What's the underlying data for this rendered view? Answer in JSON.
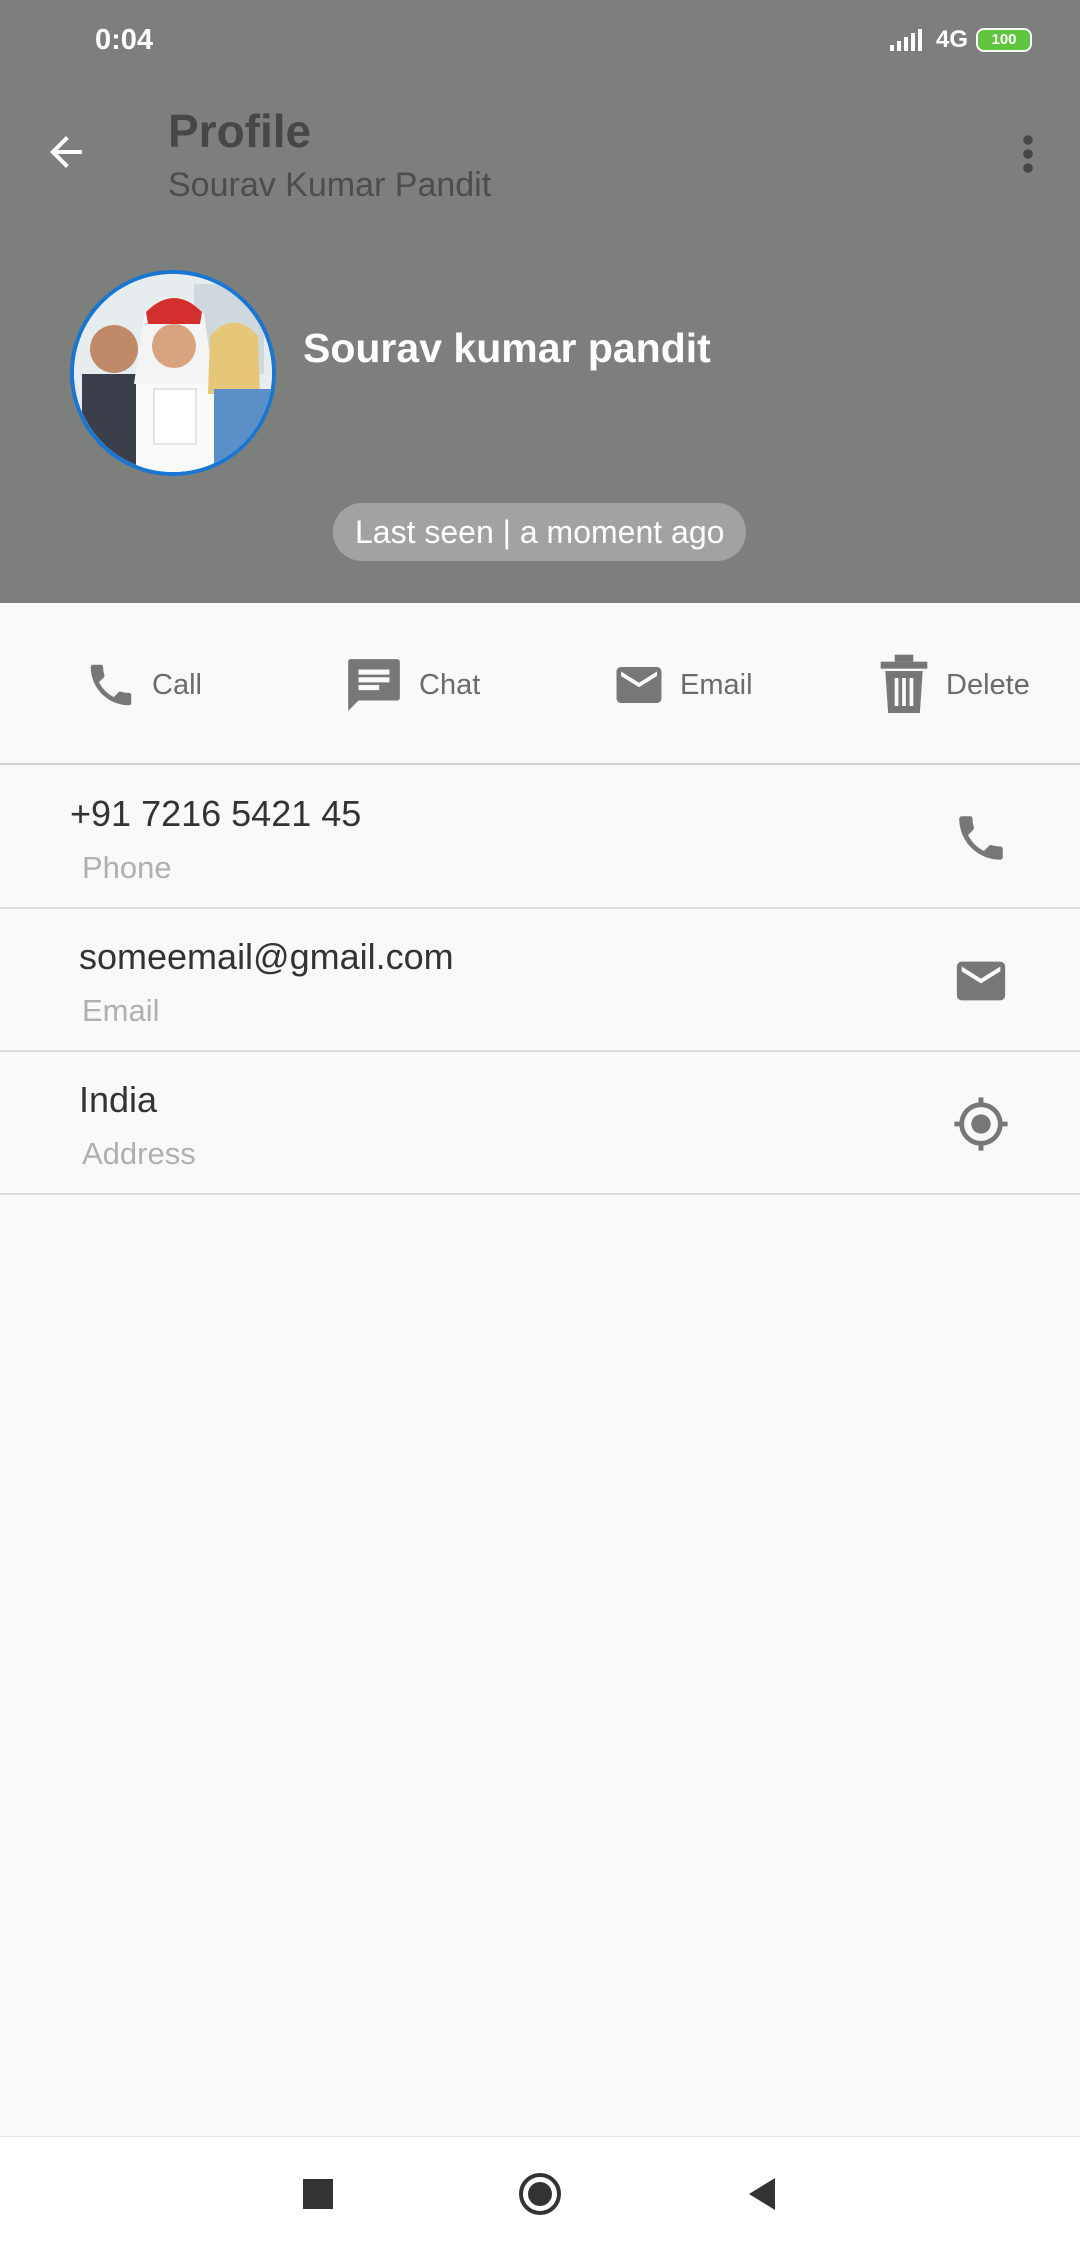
{
  "status_bar": {
    "time": "0:04",
    "network": "4G",
    "battery": "100"
  },
  "app_bar": {
    "title": "Profile",
    "subtitle": "Sourav Kumar Pandit"
  },
  "profile": {
    "name": "Sourav kumar pandit",
    "last_seen": "Last seen | a moment ago"
  },
  "actions": {
    "call": "Call",
    "chat": "Chat",
    "email": "Email",
    "delete": "Delete"
  },
  "details": {
    "phone": {
      "value": "+91 7216 5421 45",
      "label": "Phone"
    },
    "email": {
      "value": "someemail@gmail.com",
      "label": "Email"
    },
    "address": {
      "value": "India",
      "label": "Address"
    }
  },
  "colors": {
    "header_bg": "#7c7f7b",
    "avatar_ring": "#1976d2",
    "battery": "#5fc53f",
    "icon_gray": "#777777"
  },
  "icons": {
    "back": "arrow-left-icon",
    "more": "more-vert-icon",
    "call": "phone-icon",
    "chat": "chat-icon",
    "email": "mail-icon",
    "delete": "trash-icon",
    "address": "location-target-icon"
  }
}
